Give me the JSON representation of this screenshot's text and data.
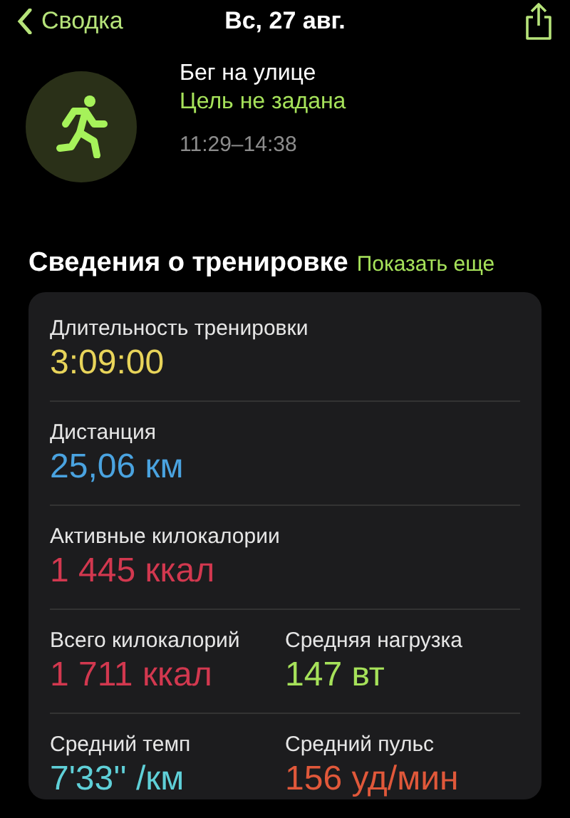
{
  "nav": {
    "back": "Сводка",
    "title": "Вс, 27 авг."
  },
  "workout": {
    "name": "Бег на улице",
    "goal": "Цель не задана",
    "time": "11:29–14:38"
  },
  "section": {
    "title": "Сведения о тренировке",
    "action": "Показать еще"
  },
  "rows": [
    [
      {
        "label": "Длительность тренировки",
        "value": "3:09:00",
        "color": "#e8d45a"
      }
    ],
    [
      {
        "label": "Дистанция",
        "value": "25,06 км",
        "color": "#4aa3e0"
      }
    ],
    [
      {
        "label": "Активные килокалории",
        "value": "1 445 ккал",
        "color": "#d2384f"
      }
    ],
    [
      {
        "label": "Всего килокалорий",
        "value": "1 711 ккал",
        "color": "#d2384f"
      },
      {
        "label": "Средняя нагрузка",
        "value": "147 вт",
        "color": "#a6e25a"
      }
    ],
    [
      {
        "label": "Средний темп",
        "value": "7'33'' /км",
        "color": "#5fd0d8"
      },
      {
        "label": "Средний пульс",
        "value": "156 уд/мин",
        "color": "#e0583a"
      }
    ]
  ]
}
